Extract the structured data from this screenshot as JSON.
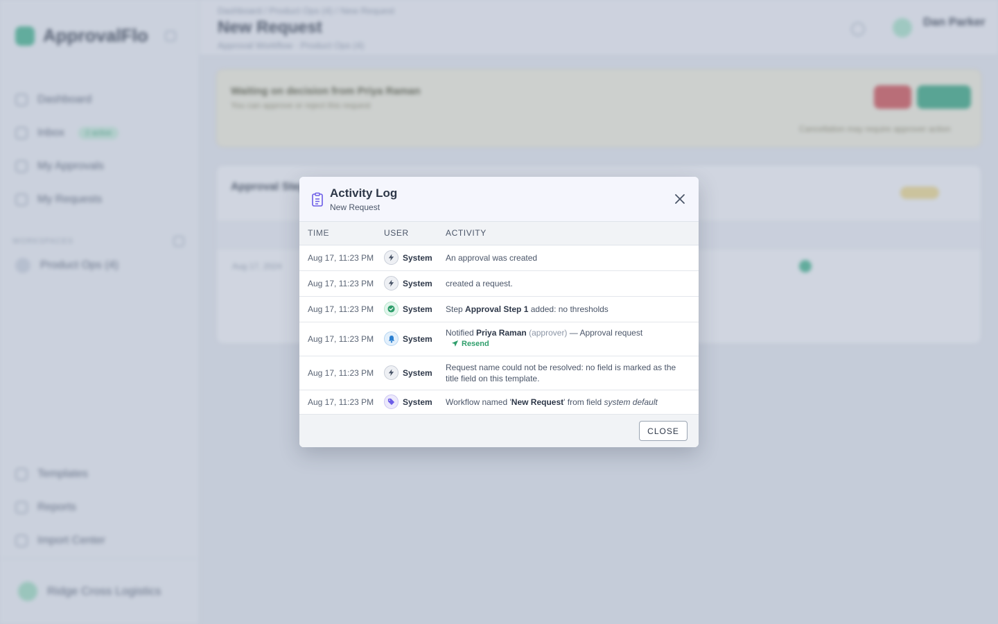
{
  "background": {
    "brand_name": "ApprovalFlo",
    "nav": [
      {
        "label": "Dashboard"
      },
      {
        "label": "Inbox",
        "badge": "2 active"
      },
      {
        "label": "My Approvals"
      },
      {
        "label": "My Requests"
      }
    ],
    "workspace_label": "WORKSPACES",
    "workspace_item": "Product Ops (4)",
    "bottom_nav": [
      {
        "label": "Templates"
      },
      {
        "label": "Reports"
      },
      {
        "label": "Import Center"
      }
    ],
    "profile_name": "Ridge Cross Logistics",
    "breadcrumb": "Dashboard  /  Product Ops (4)  /  New Request",
    "page_title": "New Request",
    "page_subtitle": "Approval Workflow  ·  Product Ops (4)",
    "user_name": "Dan Parker",
    "banner_title": "Waiting on decision from Priya Raman",
    "banner_subtitle": "You can approve or reject this request",
    "banner_note": "Cancellation may require approver action",
    "card_title": "Approval Step 1",
    "card_row": "Aug 17, 2024"
  },
  "modal": {
    "title": "Activity Log",
    "subtitle": "New Request",
    "columns": {
      "time": "TIME",
      "user": "USER",
      "activity": "ACTIVITY"
    },
    "rows": [
      {
        "time": "Aug 17, 11:23 PM",
        "user": "System",
        "icon": "bolt-icon",
        "activity": "An approval was created"
      },
      {
        "time": "Aug 17, 11:23 PM",
        "user": "System",
        "icon": "bolt-icon",
        "activity": "created a request."
      },
      {
        "time": "Aug 17, 11:23 PM",
        "user": "System",
        "icon": "check-circle-icon",
        "a_pre": "Step ",
        "a_bold": "Approval Step 1",
        "a_post": " added: no thresholds"
      },
      {
        "time": "Aug 17, 11:23 PM",
        "user": "System",
        "icon": "bell-icon",
        "a_pre": "Notified ",
        "a_bold": "Priya Raman",
        "a_role": "(approver)",
        "a_post": " — Approval request",
        "action": "Resend"
      },
      {
        "time": "Aug 17, 11:23 PM",
        "user": "System",
        "icon": "bolt-icon",
        "activity": "Request name could not be resolved: no field is marked as the title field on this template."
      },
      {
        "time": "Aug 17, 11:23 PM",
        "user": "System",
        "icon": "tag-icon",
        "a_pre": "Workflow named '",
        "a_bold": "New Request",
        "a_mid": "' from field ",
        "a_italic": "system default"
      }
    ],
    "close_label": "CLOSE"
  },
  "colors": {
    "accent": "#6b5ce7",
    "success": "#2f9e6b",
    "overlay": "#94a0b8"
  }
}
